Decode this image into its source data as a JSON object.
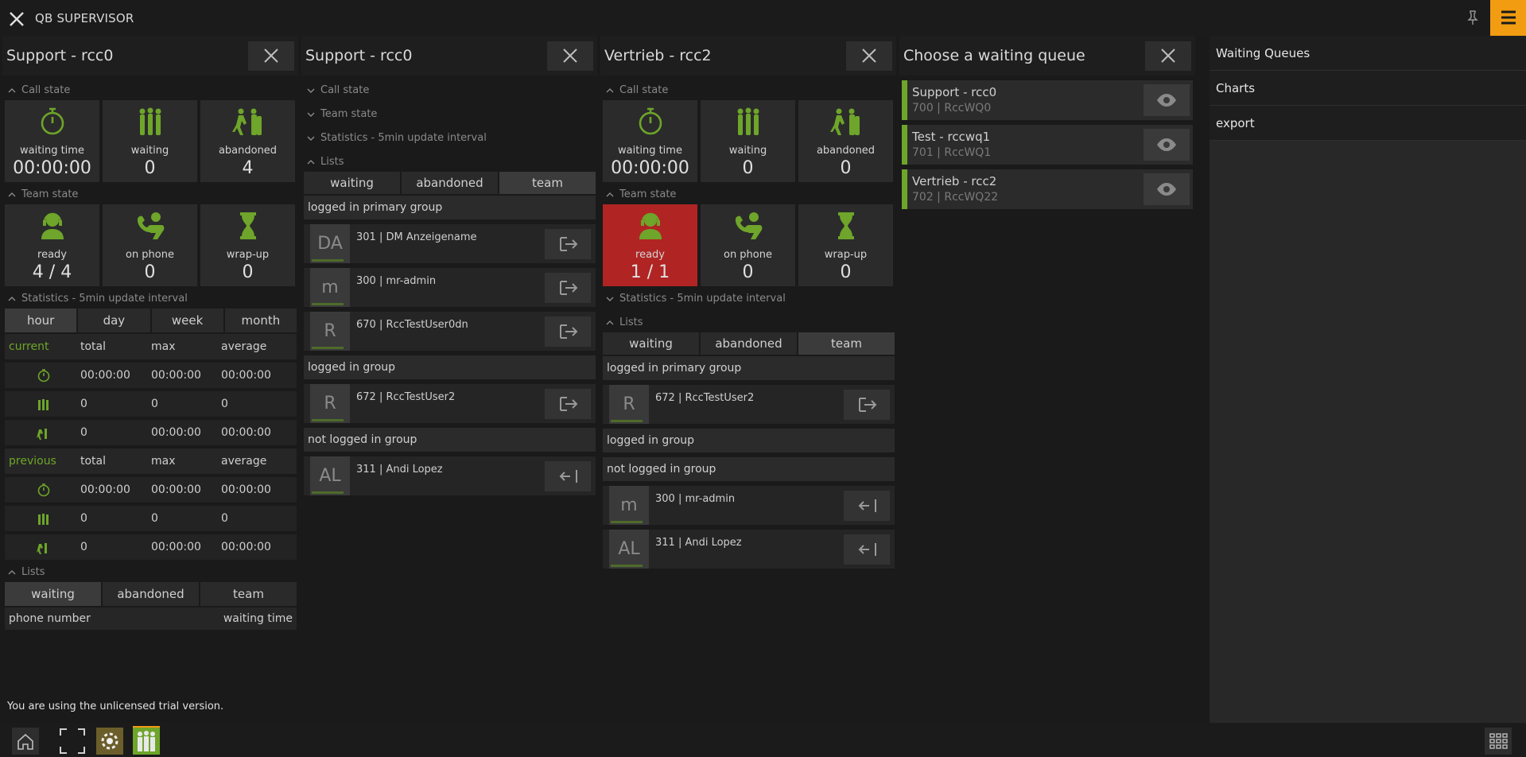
{
  "app": {
    "title": "QB SUPERVISOR"
  },
  "col1": {
    "title": "Support - rcc0",
    "call_state": "Call state",
    "call_tiles": [
      {
        "label": "waiting time",
        "value": "00:00:00"
      },
      {
        "label": "waiting",
        "value": "0"
      },
      {
        "label": "abandoned",
        "value": "4"
      }
    ],
    "team_state": "Team state",
    "team_tiles": [
      {
        "label": "ready",
        "value": "4 / 4"
      },
      {
        "label": "on phone",
        "value": "0"
      },
      {
        "label": "wrap-up",
        "value": "0"
      }
    ],
    "statistics": "Statistics - 5min update interval",
    "stat_tabs": [
      "hour",
      "day",
      "week",
      "month"
    ],
    "current_header": [
      "current",
      "total",
      "max",
      "average"
    ],
    "current_rows": [
      [
        "00:00:00",
        "00:00:00",
        "00:00:00"
      ],
      [
        "0",
        "0",
        "0"
      ],
      [
        "0",
        "00:00:00",
        "00:00:00"
      ]
    ],
    "previous_header": [
      "previous",
      "total",
      "max",
      "average"
    ],
    "previous_rows": [
      [
        "00:00:00",
        "00:00:00",
        "00:00:00"
      ],
      [
        "0",
        "0",
        "0"
      ],
      [
        "0",
        "00:00:00",
        "00:00:00"
      ]
    ],
    "lists": "Lists",
    "list_tabs": [
      "waiting",
      "abandoned",
      "team"
    ],
    "list_cols": [
      "phone number",
      "waiting time"
    ]
  },
  "col2": {
    "title": "Support - rcc0",
    "call_state": "Call state",
    "team_state": "Team state",
    "statistics": "Statistics - 5min update interval",
    "lists": "Lists",
    "list_tabs": [
      "waiting",
      "abandoned",
      "team"
    ],
    "g1": "logged in primary group",
    "g1_agents": [
      {
        "av": "DA",
        "name": "301 | DM Anzeigename"
      },
      {
        "av": "m",
        "name": "300 | mr-admin"
      },
      {
        "av": "R",
        "name": "670 | RccTestUser0dn"
      }
    ],
    "g2": "logged in group",
    "g2_agents": [
      {
        "av": "R",
        "name": "672 | RccTestUser2"
      }
    ],
    "g3": "not logged in group",
    "g3_agents": [
      {
        "av": "AL",
        "name": "311 | Andi Lopez"
      }
    ]
  },
  "col3": {
    "title": "Vertrieb - rcc2",
    "call_state": "Call state",
    "call_tiles": [
      {
        "label": "waiting time",
        "value": "00:00:00"
      },
      {
        "label": "waiting",
        "value": "0"
      },
      {
        "label": "abandoned",
        "value": "0"
      }
    ],
    "team_state": "Team state",
    "team_tiles": [
      {
        "label": "ready",
        "value": "1 / 1"
      },
      {
        "label": "on phone",
        "value": "0"
      },
      {
        "label": "wrap-up",
        "value": "0"
      }
    ],
    "statistics": "Statistics - 5min update interval",
    "lists": "Lists",
    "list_tabs": [
      "waiting",
      "abandoned",
      "team"
    ],
    "g1": "logged in primary group",
    "g1_agents": [
      {
        "av": "R",
        "name": "672 | RccTestUser2"
      }
    ],
    "g2": "logged in group",
    "g3": "not logged in group",
    "g3_agents": [
      {
        "av": "m",
        "name": "300 | mr-admin"
      },
      {
        "av": "AL",
        "name": "311 | Andi Lopez"
      }
    ]
  },
  "col4": {
    "title": "Choose a waiting queue",
    "queues": [
      {
        "name": "Support - rcc0",
        "sub": "700 | RccWQ0"
      },
      {
        "name": "Test - rccwq1",
        "sub": "701 | RccWQ1"
      },
      {
        "name": "Vertrieb - rcc2",
        "sub": "702 | RccWQ22"
      }
    ]
  },
  "sidebar": {
    "items": [
      "Waiting Queues",
      "Charts",
      "export"
    ]
  },
  "trial": "You are using the unlicensed trial version.",
  "colors": {
    "accent": "#f29c11",
    "green": "#6ea52a",
    "alert": "#b12424"
  }
}
